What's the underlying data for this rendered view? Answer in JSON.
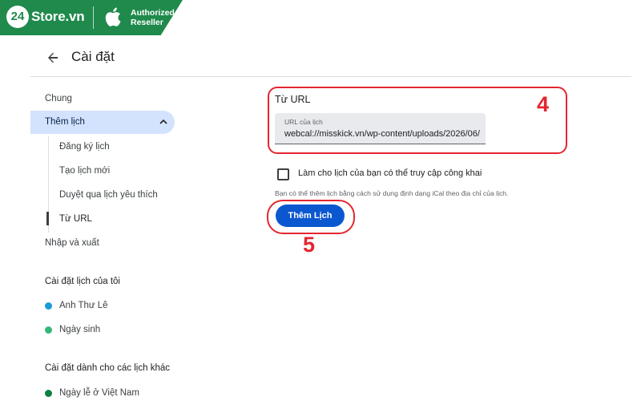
{
  "brand": {
    "logo_number": "24",
    "logo_text": "Store.vn",
    "reseller_text": "Authorized Reseller",
    "brand_color": "#1f8a4c"
  },
  "header": {
    "back_icon": "arrow-left-icon",
    "title": "Cài đặt"
  },
  "sidebar": {
    "general": "Chung",
    "add_calendar": {
      "label": "Thêm lịch",
      "expanded": true,
      "icon": "chevron-up-icon",
      "items": [
        "Đăng ký lịch",
        "Tạo lịch mới",
        "Duyệt qua lịch yêu thích",
        "Từ URL"
      ],
      "selected_item": "Từ URL"
    },
    "import_export": "Nhập và xuất",
    "my_calendars": {
      "heading": "Cài đặt lịch của tôi",
      "items": [
        {
          "label": "Anh Thư Lê",
          "color": "#1a9bd7"
        },
        {
          "label": "Ngày sinh",
          "color": "#33b679"
        }
      ]
    },
    "other_calendars": {
      "heading": "Cài đặt dành cho các lịch khác",
      "items": [
        {
          "label": "Ngày lễ ở Việt Nam",
          "color": "#0b8043"
        }
      ]
    }
  },
  "main": {
    "section_title": "Từ URL",
    "url_field": {
      "label": "URL của lịch",
      "value": "webcal://misskick.vn/wp-content/uploads/2026/06/"
    },
    "public_checkbox": {
      "label": "Làm cho lịch của bạn có thể truy cập công khai",
      "checked": false
    },
    "help_text": "Bạn có thể thêm lịch bằng cách sử dụng định dạng iCal theo địa chỉ của lịch.",
    "add_button": "Thêm Lịch",
    "accent_color": "#0b57d0"
  },
  "annotations": {
    "step_4": "4",
    "step_5": "5",
    "color": "#e4262f"
  }
}
